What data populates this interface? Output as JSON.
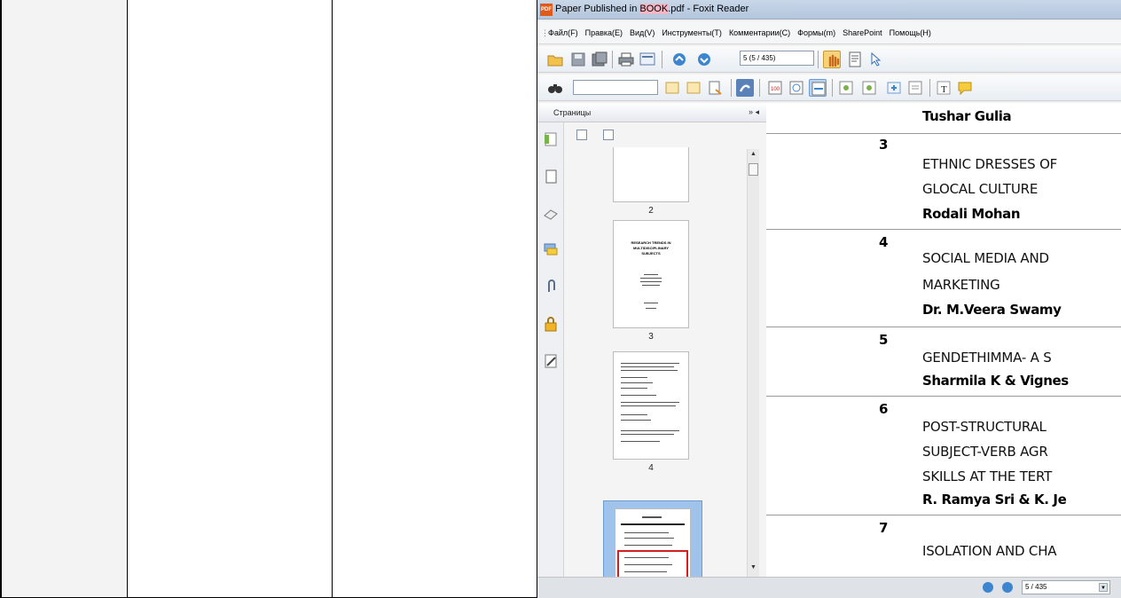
{
  "window": {
    "app_icon_text": "PDF",
    "title_prefix": "Paper Published in ",
    "title_highlight": "BOOK",
    "title_suffix": ".pdf - Foxit Reader"
  },
  "menu": [
    "Файл(F)",
    "Правка(E)",
    "Вид(V)",
    "Инструменты(T)",
    "Комментарии(C)",
    "Формы(m)",
    "SharePoint",
    "Помощь(H)"
  ],
  "toolbar": {
    "page_field_value": "5 (5 / 435)"
  },
  "pages_panel": {
    "title": "Страницы",
    "controls": "» ◂",
    "thumbnail_labels": [
      "2",
      "3",
      "4"
    ],
    "thumb3_heading": [
      "RESEARCH TRENDS IN",
      "MULTIDISCIPLINARY",
      "SUBJECTS"
    ]
  },
  "document": {
    "entries": [
      {
        "author": "Tushar Gulia"
      },
      {
        "num": "3",
        "lines": [
          "ETHNIC DRESSES OF",
          "GLOCAL CULTURE"
        ],
        "author": "Rodali Mohan"
      },
      {
        "num": "4",
        "lines": [
          "SOCIAL MEDIA AND",
          "MARKETING"
        ],
        "author": "Dr. M.Veera Swamy"
      },
      {
        "num": "5",
        "lines": [
          "GENDETHIMMA- A S"
        ],
        "author": "Sharmila K & Vignes"
      },
      {
        "num": "6",
        "lines": [
          "POST-STRUCTURAL",
          "SUBJECT-VERB AGR",
          "SKILLS AT THE TERT"
        ],
        "author": "R. Ramya Sri & K. Je"
      },
      {
        "num": "7",
        "lines": [
          "ISOLATION AND CHA"
        ]
      }
    ]
  },
  "statusbar": {
    "page_value": "5 / 435"
  },
  "colors": {
    "title_gradient": "#c9d7e8",
    "selection": "#9fc3eb",
    "highlight_box": "#d02020",
    "nav_blue": "#3d86cf"
  }
}
